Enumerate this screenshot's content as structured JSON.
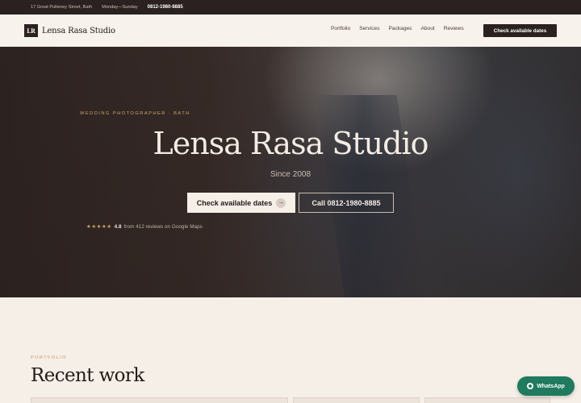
{
  "topbar": {
    "address": "17 Great Pulteney Street, Bath",
    "hours": "Monday—Sunday",
    "phone": "0812-1980-8885"
  },
  "nav": {
    "logo_mark": "LR",
    "brand": "Lensa Rasa Studio",
    "items": [
      {
        "label": "Portfolio"
      },
      {
        "label": "Services"
      },
      {
        "label": "Packages"
      },
      {
        "label": "About"
      },
      {
        "label": "Reviews"
      }
    ],
    "cta": "Check available dates"
  },
  "hero": {
    "eyebrow": "WEDDING PHOTOGRAPHER · BATH",
    "title": "Lensa Rasa Studio",
    "subtitle": "Since 2008",
    "primary_button": "Check available dates",
    "primary_arrow": "→",
    "secondary_button": "Call 0812-1980-8885",
    "rating": {
      "stars": "★★★★★",
      "score": "4.8",
      "text": "from 412 reviews on Google Maps"
    }
  },
  "portfolio": {
    "eyebrow": "PORTFOLIO",
    "title": "Recent work"
  },
  "whatsapp": {
    "label": "WhatsApp"
  },
  "colors": {
    "dark": "#2b2120",
    "accent_gold": "#c9a26a",
    "cream": "#f6efe8",
    "whatsapp_green": "#1f7a5e"
  }
}
